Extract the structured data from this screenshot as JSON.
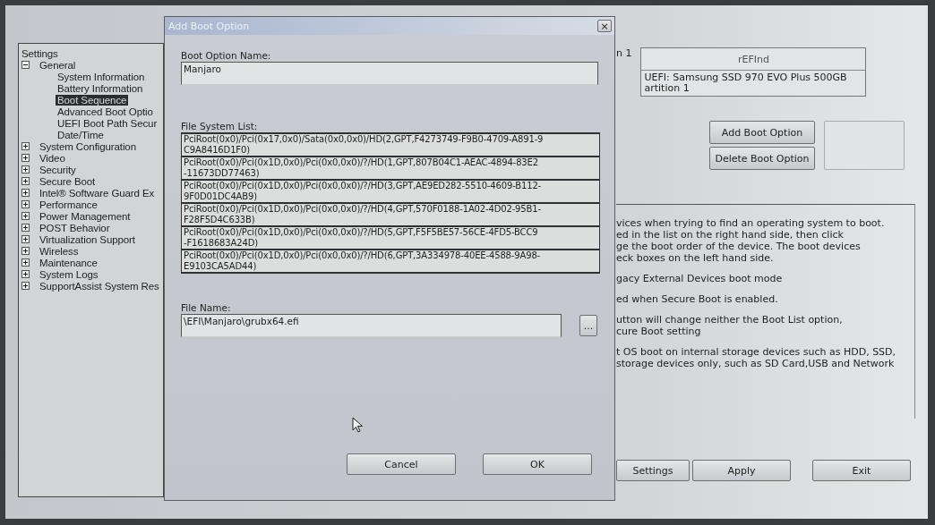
{
  "tree": {
    "title": "Settings",
    "items": [
      {
        "label": "General",
        "expanded": true,
        "selected": false,
        "children": [
          {
            "label": "System Information",
            "selected": false
          },
          {
            "label": "Battery Information",
            "selected": false
          },
          {
            "label": "Boot Sequence",
            "selected": true
          },
          {
            "label": "Advanced Boot Optio",
            "selected": false
          },
          {
            "label": "UEFI Boot Path Secur",
            "selected": false
          },
          {
            "label": "Date/Time",
            "selected": false
          }
        ]
      },
      {
        "label": "System Configuration",
        "expanded": false,
        "selected": false
      },
      {
        "label": "Video",
        "expanded": false,
        "selected": false
      },
      {
        "label": "Security",
        "expanded": false,
        "selected": false
      },
      {
        "label": "Secure Boot",
        "expanded": false,
        "selected": false
      },
      {
        "label": "Intel® Software Guard Ex",
        "expanded": false,
        "selected": false
      },
      {
        "label": "Performance",
        "expanded": false,
        "selected": false
      },
      {
        "label": "Power Management",
        "expanded": false,
        "selected": false
      },
      {
        "label": "POST Behavior",
        "expanded": false,
        "selected": false
      },
      {
        "label": "Virtualization Support",
        "expanded": false,
        "selected": false
      },
      {
        "label": "Wireless",
        "expanded": false,
        "selected": false
      },
      {
        "label": "Maintenance",
        "expanded": false,
        "selected": false
      },
      {
        "label": "System Logs",
        "expanded": false,
        "selected": false
      },
      {
        "label": "SupportAssist System Res",
        "expanded": false,
        "selected": false
      }
    ]
  },
  "boot_list": {
    "label": "n 1",
    "header": "rEFInd",
    "entries": [
      {
        "text": "UEFI: Samsung SSD 970 EVO Plus 500GB",
        "continuation": "artition 1"
      }
    ]
  },
  "list_buttons": [
    "Add Boot Option",
    "Delete Boot Option"
  ],
  "description": [
    "vices when trying to find an operating system to boot.",
    "ed in the list on the right hand side, then click",
    "ge the boot order of the device. The boot devices",
    "eck boxes on the left hand side.",
    "gacy External Devices boot mode",
    "ed when Secure Boot is enabled.",
    "utton will change neither the Boot List option,",
    "cure Boot setting",
    "t OS boot on internal storage devices such as HDD, SSD,",
    "storage devices only, such as SD Card,USB and Network"
  ],
  "bottom_buttons": [
    "Settings",
    "Apply",
    "Exit"
  ],
  "dialog": {
    "title": "Add Boot Option",
    "close": "×",
    "name_label": "Boot Option Name:",
    "name_value": "Manjaro",
    "fs_label": "File System List:",
    "file_systems": [
      {
        "line1": "PciRoot(0x0)/Pci(0x17,0x0)/Sata(0x0,0x0)/HD(2,GPT,F4273749-F9B0-4709-A891-9",
        "line2": "C9A8416D1F0)",
        "selected": false
      },
      {
        "line1": "PciRoot(0x0)/Pci(0x1D,0x0)/Pci(0x0,0x0)/?/HD(1,GPT,807B04C1-AEAC-4894-83E2",
        "line2": "-11673DD77463)",
        "selected": false
      },
      {
        "line1": "PciRoot(0x0)/Pci(0x1D,0x0)/Pci(0x0,0x0)/?/HD(3,GPT,AE9ED282-5510-4609-B112-",
        "line2": "9F0D01DC4AB9)",
        "selected": false
      },
      {
        "line1": "PciRoot(0x0)/Pci(0x1D,0x0)/Pci(0x0,0x0)/?/HD(4,GPT,570F0188-1A02-4D02-95B1-",
        "line2": "F28F5D4C633B)",
        "selected": false
      },
      {
        "line1": "PciRoot(0x0)/Pci(0x1D,0x0)/Pci(0x0,0x0)/?/HD(5,GPT,F5F5BE57-56CE-4FD5-BCC9",
        "line2": "-F1618683A24D)",
        "selected": false
      },
      {
        "line1": "PciRoot(0x0)/Pci(0x1D,0x0)/Pci(0x0,0x0)/?/HD(6,GPT,3A334978-40EE-4588-9A98-",
        "line2": "E9103CA5AD44)",
        "selected": false
      }
    ],
    "file_label": "File Name:",
    "file_value": "\\EFI\\Manjaro\\grubx64.efi",
    "browse": "...",
    "buttons": [
      "Cancel",
      "OK"
    ]
  }
}
